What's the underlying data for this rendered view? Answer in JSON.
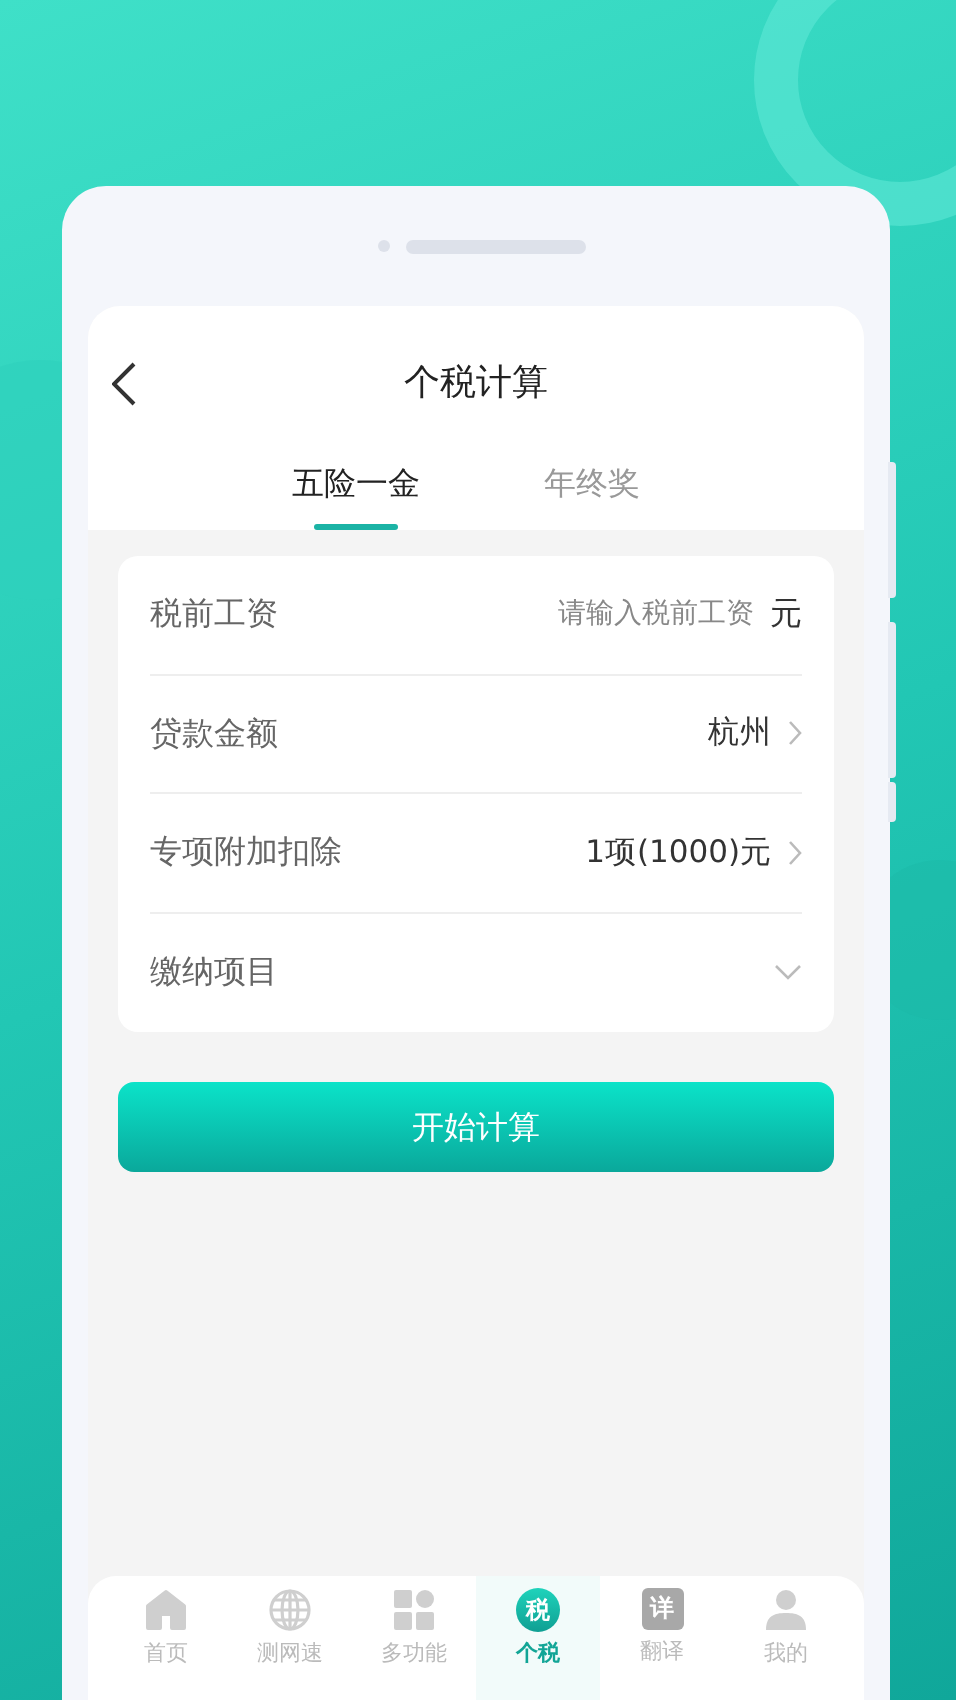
{
  "header": {
    "title": "个税计算"
  },
  "tabs": [
    {
      "label": "五险一金",
      "selected": true
    },
    {
      "label": "年终奖",
      "selected": false
    }
  ],
  "form_rows": [
    {
      "kind": "input",
      "label": "税前工资",
      "placeholder": "请输入税前工资",
      "unit": "元"
    },
    {
      "kind": "select",
      "label": "贷款金额",
      "value": "杭州"
    },
    {
      "kind": "select",
      "label": "专项附加扣除",
      "value": "1项(1000)元"
    },
    {
      "kind": "dropdown",
      "label": "缴纳项目"
    }
  ],
  "primary_button": {
    "label": "开始计算"
  },
  "bottom_nav": [
    {
      "kind": "home",
      "label": "首页",
      "selected": false
    },
    {
      "kind": "globe",
      "label": "测网速",
      "selected": false
    },
    {
      "kind": "grid",
      "label": "多功能",
      "selected": false
    },
    {
      "kind": "glyph",
      "glyph": "税",
      "label": "个税",
      "selected": true
    },
    {
      "kind": "square-glyph",
      "glyph": "详",
      "label": "翻译",
      "selected": false
    },
    {
      "kind": "person",
      "label": "我的",
      "selected": false
    }
  ]
}
